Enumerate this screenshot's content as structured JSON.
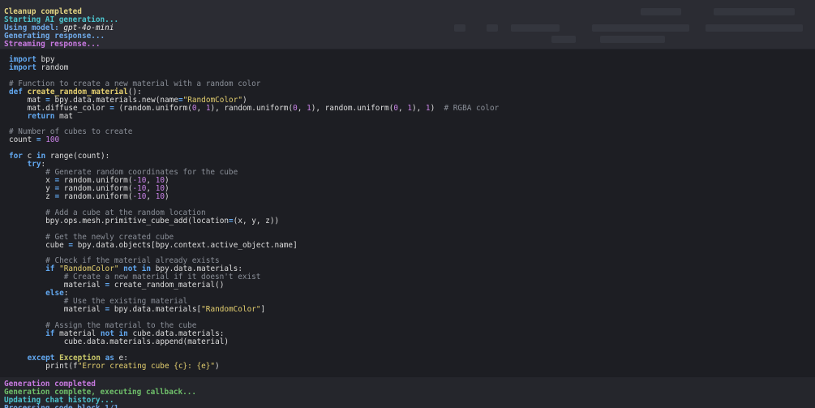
{
  "log_top": [
    {
      "text": "Cleanup completed",
      "color": "#e3d483"
    },
    {
      "text": "Starting AI generation...",
      "color": "#4cc3cc"
    },
    {
      "prefix": "Using model: ",
      "model": "gpt-4o-mini",
      "color": "#6fa9e8"
    },
    {
      "text": "Generating response...",
      "color": "#6fa9e8"
    },
    {
      "text": "Streaming response...",
      "color": "#c779e0"
    }
  ],
  "log_bottom": [
    {
      "text": "Generation completed",
      "color": "#c779e0"
    },
    {
      "text": "Generation complete, executing callback...",
      "color": "#6fbf6a"
    },
    {
      "text": "Updating chat history...",
      "color": "#4cc3cc"
    },
    {
      "text": "Processing code block 1/1",
      "color": "#6fa9e8"
    }
  ],
  "code": {
    "language": "python",
    "lines": [
      "import bpy",
      "import random",
      "",
      "# Function to create a new material with a random color",
      "def create_random_material():",
      "    mat = bpy.data.materials.new(name=\"RandomColor\")",
      "    mat.diffuse_color = (random.uniform(0, 1), random.uniform(0, 1), random.uniform(0, 1), 1)  # RGBA color",
      "    return mat",
      "",
      "# Number of cubes to create",
      "count = 100",
      "",
      "for c in range(count):",
      "    try:",
      "        # Generate random coordinates for the cube",
      "        x = random.uniform(-10, 10)",
      "        y = random.uniform(-10, 10)",
      "        z = random.uniform(-10, 10)",
      "",
      "        # Add a cube at the random location",
      "        bpy.ops.mesh.primitive_cube_add(location=(x, y, z))",
      "",
      "        # Get the newly created cube",
      "        cube = bpy.data.objects[bpy.context.active_object.name]",
      "",
      "        # Check if the material already exists",
      "        if \"RandomColor\" not in bpy.data.materials:",
      "            # Create a new material if it doesn't exist",
      "            material = create_random_material()",
      "        else:",
      "            # Use the existing material",
      "            material = bpy.data.materials[\"RandomColor\"]",
      "",
      "        # Assign the material to the cube",
      "        if material not in cube.data.materials:",
      "            cube.data.materials.append(material)",
      "",
      "    except Exception as e:",
      "        print(f\"Error creating cube {c}: {e}\")"
    ]
  }
}
